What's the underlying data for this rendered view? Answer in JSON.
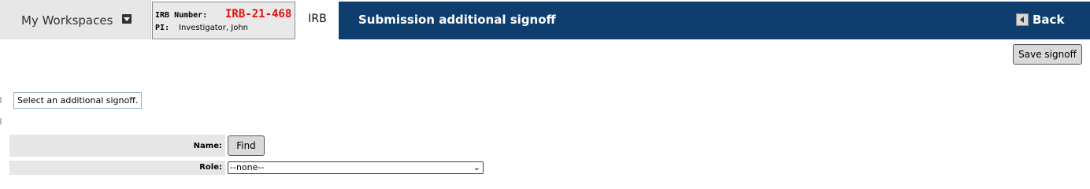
{
  "header": {
    "workspaces_label": "My Workspaces",
    "irb_number_label": "IRB Number:",
    "irb_number_value": "IRB-21-468",
    "pi_label": "PI:",
    "pi_value": "Investigator, John",
    "tab_label": "IRB",
    "page_title": "Submission additional signoff",
    "back_label": "Back"
  },
  "toolbar": {
    "save_label": "Save signoff"
  },
  "hint": "Select an additional signoff.",
  "form": {
    "name_label": "Name:",
    "find_label": "Find",
    "role_label": "Role:",
    "role_value": "--none--"
  },
  "colors": {
    "title_bar": "#0e3e6e",
    "irb_number": "#e01010",
    "workspace_bg": "#e7e7e7"
  },
  "icons": {
    "workspace_dropdown": "caret-down-icon",
    "back": "arrow-left-icon",
    "select_chevron": "chevron-down-icon"
  }
}
